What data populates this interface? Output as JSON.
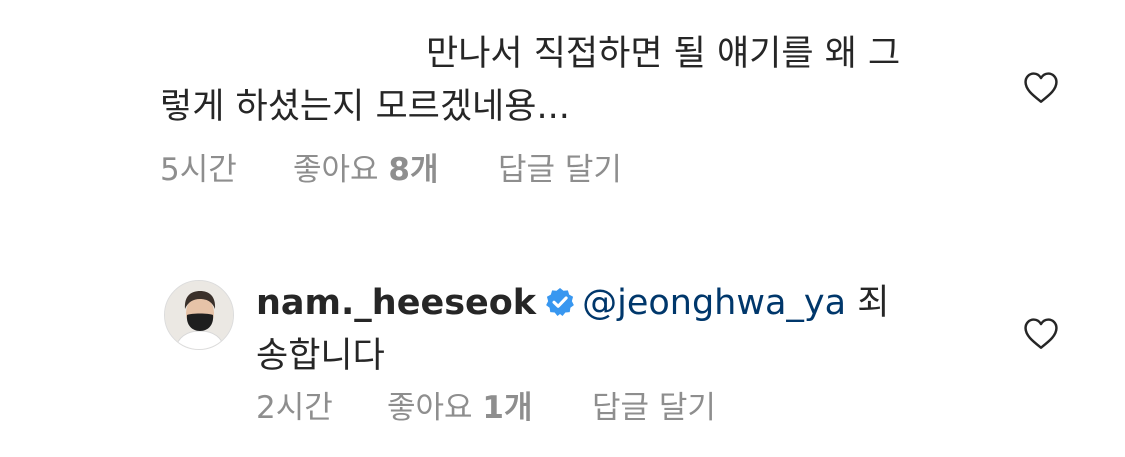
{
  "comments": [
    {
      "text_line1": "만나서 직접하면 될 얘기를 왜 그",
      "text_line2": "렇게 하셨는지 모르겠네용...",
      "time": "5시간",
      "likes_prefix": "좋아요",
      "likes_count": "8개",
      "reply_label": "답글 달기",
      "heart_icon": "heart-outline-icon"
    },
    {
      "username": "nam._heeseok",
      "verified_icon": "verified-badge-icon",
      "mention": "@jeonghwa_ya",
      "text_after_mention": " 죄",
      "text_line2": "송합니다",
      "time": "2시간",
      "likes_prefix": "좋아요",
      "likes_count": "1개",
      "reply_label": "답글 달기",
      "heart_icon": "heart-outline-icon"
    }
  ],
  "colors": {
    "text": "#262626",
    "secondary": "#8e8e8e",
    "mention": "#00376b",
    "verified": "#3897f0"
  }
}
